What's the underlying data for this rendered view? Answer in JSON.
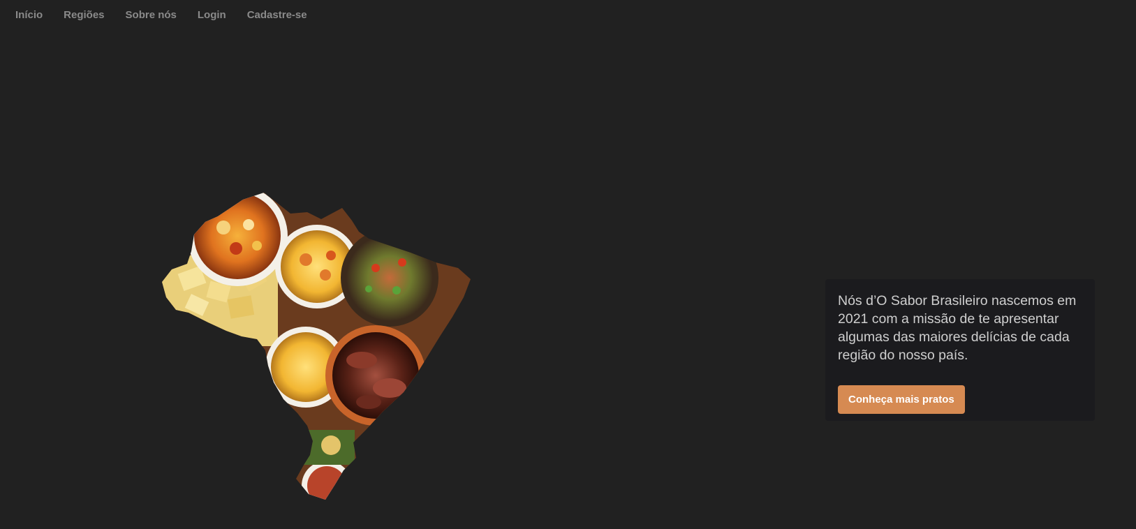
{
  "nav": {
    "items": [
      {
        "label": "Início"
      },
      {
        "label": "Regiões"
      },
      {
        "label": "Sobre nós"
      },
      {
        "label": "Login"
      },
      {
        "label": "Cadastre-se"
      }
    ]
  },
  "hero": {
    "image_icon": "brazil-map-food-collage-icon",
    "description": "Nós d’O Sabor Brasileiro nascemos em 2021 com a missão de te apresentar algumas das maiores delícias de cada região do nosso país.",
    "cta_label": "Conheça mais pratos"
  },
  "colors": {
    "background": "#212121",
    "nav_text": "#8a8a8a",
    "card_background": "#1b1b1e",
    "card_text": "#cfcfcf",
    "accent": "#d68a52"
  }
}
